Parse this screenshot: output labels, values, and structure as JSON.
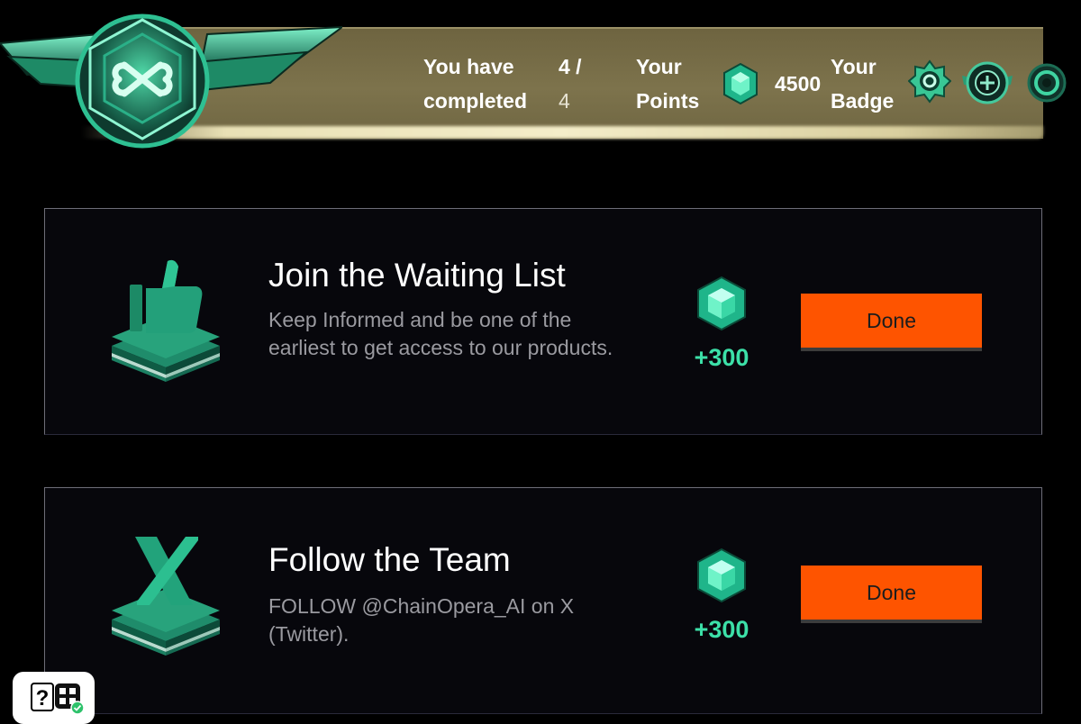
{
  "header": {
    "completed_label_line1": "You have",
    "completed_label_line2": "completed",
    "completed_count": "4 /",
    "completed_total": "4",
    "points_label_line1": "Your",
    "points_label_line2": "Points",
    "points_value": "4500",
    "badge_label_line1": "Your",
    "badge_label_line2": "Badge",
    "points_icon": "gem-icon",
    "badge_icons": [
      "badge-star-icon",
      "badge-wings-icon",
      "badge-ring-icon"
    ]
  },
  "tasks": [
    {
      "icon": "thumbs-up-icon",
      "title": "Join the Waiting List",
      "description": "Keep Informed and be one of the earliest to get access to our products.",
      "reward": "+300",
      "button_label": "Done"
    },
    {
      "icon": "x-logo-icon",
      "title": "Follow the Team",
      "description": "FOLLOW @ChainOpera_AI on X (Twitter).",
      "reward": "+300",
      "button_label": "Done"
    }
  ],
  "help_widget": {
    "label": "?"
  },
  "colors": {
    "accent_green": "#3ce0a8",
    "button_orange": "#fe5400",
    "banner_gold": "#7d734c",
    "background": "#000000"
  }
}
